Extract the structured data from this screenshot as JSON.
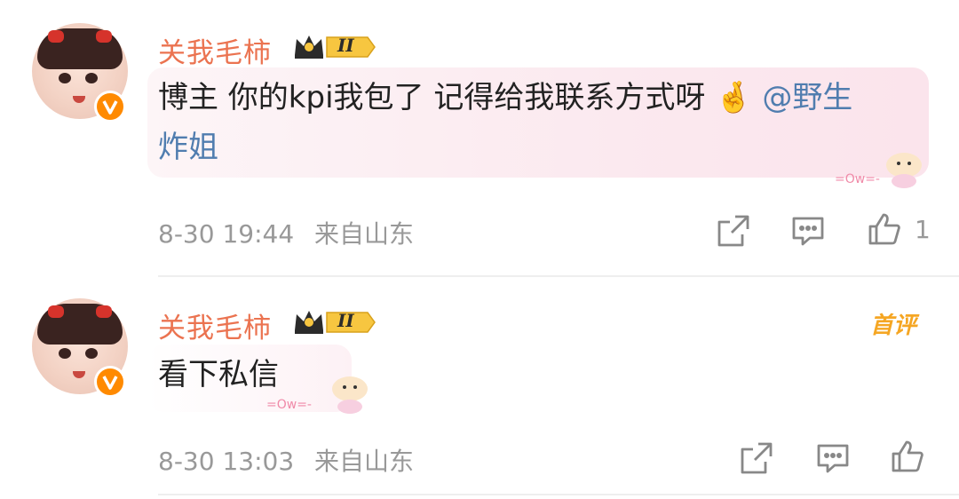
{
  "comments": [
    {
      "username": "关我毛柿",
      "level_badge": "II",
      "verified_icon": "verified-v-icon",
      "text_main": "博主 你的kpi我包了 记得给我联系方式呀",
      "emoji": "🤞",
      "mention_line1": "@野生",
      "mention_line2": "炸姐",
      "timestamp": "8-30 19:44",
      "location": "来自山东",
      "like_count": "1",
      "sticker_text": "=Ow=-"
    },
    {
      "username": "关我毛柿",
      "level_badge": "II",
      "verified_icon": "verified-v-icon",
      "first_badge": "首评",
      "text_main": "看下私信",
      "timestamp": "8-30 13:03",
      "location": "来自山东",
      "sticker_text": "=Ow=-"
    }
  ],
  "icons": [
    "share-icon",
    "comment-icon",
    "like-icon",
    "crown-icon",
    "verified-v-icon"
  ],
  "colors": {
    "username": "#eb7350",
    "mention": "#507daf",
    "meta": "#999999",
    "badge": "#ff8a00",
    "first_badge": "#f5a623"
  }
}
